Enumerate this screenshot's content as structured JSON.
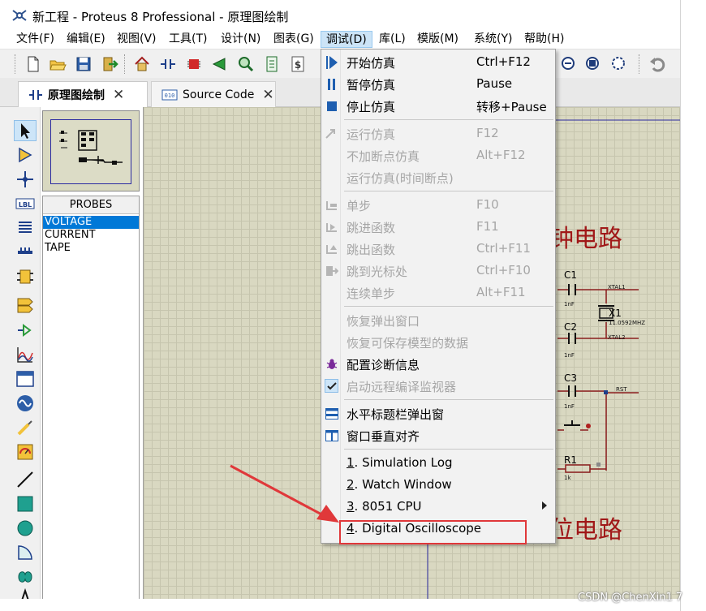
{
  "window": {
    "title": "新工程 - Proteus 8 Professional - 原理图绘制"
  },
  "menubar": [
    {
      "label": "文件(F)"
    },
    {
      "label": "编辑(E)"
    },
    {
      "label": "视图(V)"
    },
    {
      "label": "工具(T)"
    },
    {
      "label": "设计(N)"
    },
    {
      "label": "图表(G)"
    },
    {
      "label": "调试(D)"
    },
    {
      "label": "库(L)"
    },
    {
      "label": "模版(M)"
    },
    {
      "label": "系统(Y)"
    },
    {
      "label": "帮助(H)"
    }
  ],
  "tabs": [
    {
      "label": "原理图绘制",
      "icon": "schematic-icon",
      "active": true
    },
    {
      "label": "Source Code",
      "icon": "source-code-icon",
      "active": false
    }
  ],
  "probes": {
    "header": "PROBES",
    "items": [
      "VOLTAGE",
      "CURRENT",
      "TAPE"
    ],
    "selected": "VOLTAGE"
  },
  "debug_menu": {
    "items": [
      {
        "label": "开始仿真",
        "shortcut": "Ctrl+F12",
        "icon": "play-icon",
        "enabled": true
      },
      {
        "label": "暂停仿真",
        "shortcut": "Pause",
        "icon": "pause-icon",
        "enabled": true
      },
      {
        "label": "停止仿真",
        "shortcut": "转移+Pause",
        "icon": "stop-icon",
        "enabled": true
      },
      {
        "label": "运行仿真",
        "shortcut": "F12",
        "icon": "run-icon",
        "enabled": false
      },
      {
        "label": "不加断点仿真",
        "shortcut": "Alt+F12",
        "icon": "",
        "enabled": false
      },
      {
        "label": "运行仿真(时间断点)",
        "shortcut": "",
        "icon": "",
        "enabled": false
      },
      {
        "label": "单步",
        "shortcut": "F10",
        "icon": "step-icon",
        "enabled": false
      },
      {
        "label": "跳进函数",
        "shortcut": "F11",
        "icon": "step-into-icon",
        "enabled": false
      },
      {
        "label": "跳出函数",
        "shortcut": "Ctrl+F11",
        "icon": "step-out-icon",
        "enabled": false
      },
      {
        "label": "跳到光标处",
        "shortcut": "Ctrl+F10",
        "icon": "run-to-cursor-icon",
        "enabled": false
      },
      {
        "label": "连续单步",
        "shortcut": "Alt+F11",
        "icon": "",
        "enabled": false
      },
      {
        "label": "恢复弹出窗口",
        "shortcut": "",
        "icon": "",
        "enabled": false
      },
      {
        "label": "恢复可保存模型的数据",
        "shortcut": "",
        "icon": "",
        "enabled": false
      },
      {
        "label": "配置诊断信息",
        "shortcut": "",
        "icon": "bug-icon",
        "enabled": true
      },
      {
        "label": "启动远程编译监视器",
        "shortcut": "",
        "icon": "checkmark-icon",
        "enabled": false
      },
      {
        "label": "水平标题栏弹出窗",
        "shortcut": "",
        "icon": "tile-horizontal-icon",
        "enabled": true
      },
      {
        "label": "窗口垂直对齐",
        "shortcut": "",
        "icon": "tile-vertical-icon",
        "enabled": true
      },
      {
        "label": "1. Simulation Log",
        "shortcut": "",
        "icon": "",
        "enabled": true
      },
      {
        "label": "2. Watch Window",
        "shortcut": "",
        "icon": "",
        "enabled": true
      },
      {
        "label": "3. 8051 CPU",
        "shortcut": "",
        "icon": "",
        "enabled": true,
        "submenu": true
      },
      {
        "label": "4. Digital Oscilloscope",
        "shortcut": "",
        "icon": "",
        "enabled": true
      }
    ]
  },
  "schematic": {
    "heading1": "钟电路",
    "heading2": "位电路",
    "components": {
      "c1": "C1",
      "c1_value": "1nF",
      "c2": "C2",
      "c2_value": "1nF",
      "c3": "C3",
      "c3_value": "1nF",
      "x1": "X1",
      "x1_value": "11.0592MHZ",
      "r1": "R1",
      "r1_value": "1k",
      "net_xtal1": "XTAL1",
      "net_xtal2": "XTAL2",
      "net_rst": "RST"
    }
  },
  "annotation": {
    "color": "#e0383a"
  },
  "watermark": "CSDN @ChenXin1 7"
}
